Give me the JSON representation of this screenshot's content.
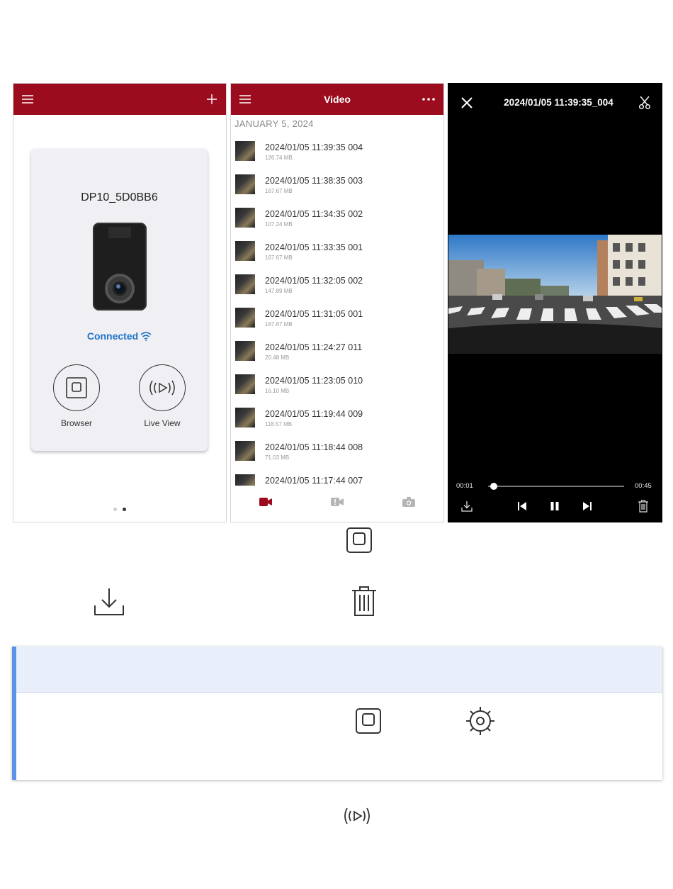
{
  "colors": {
    "brand_red": "#9b0c1e",
    "connected_blue": "#1f74c9",
    "accent_blue": "#5b93e8"
  },
  "home": {
    "device_name": "DP10_5D0BB6",
    "status": "Connected",
    "browser_label": "Browser",
    "live_view_label": "Live View",
    "page_indicator": {
      "pages": 2,
      "current": 2
    }
  },
  "video": {
    "title": "Video",
    "date_header": "JANUARY 5, 2024",
    "items": [
      {
        "name": "2024/01/05 11:39:35  004",
        "size": "126.74 MB"
      },
      {
        "name": "2024/01/05 11:38:35  003",
        "size": "167.67 MB"
      },
      {
        "name": "2024/01/05 11:34:35  002",
        "size": "107.24 MB"
      },
      {
        "name": "2024/01/05 11:33:35  001",
        "size": "167.67 MB"
      },
      {
        "name": "2024/01/05 11:32:05  002",
        "size": "147.89 MB"
      },
      {
        "name": "2024/01/05 11:31:05  001",
        "size": "167.67 MB"
      },
      {
        "name": "2024/01/05 11:24:27  011",
        "size": "20.48 MB"
      },
      {
        "name": "2024/01/05 11:23:05  010",
        "size": "16.10 MB"
      },
      {
        "name": "2024/01/05 11:19:44  009",
        "size": "118.57 MB"
      },
      {
        "name": "2024/01/05 11:18:44  008",
        "size": "71.03 MB"
      },
      {
        "name": "2024/01/05 11:17:44  007",
        "size": ""
      }
    ],
    "tabs": [
      "video-tab",
      "event-tab",
      "photo-tab"
    ]
  },
  "player": {
    "title": "2024/01/05 11:39:35_004",
    "elapsed": "00:01",
    "duration": "00:45",
    "progress": 0.022
  },
  "icons": [
    "menu-icon",
    "plus-icon",
    "more-icon",
    "close-icon",
    "scissors-icon",
    "download-icon",
    "previous-icon",
    "pause-icon",
    "next-icon",
    "trash-icon",
    "browser-icon",
    "live-view-icon",
    "settings-icon",
    "wifi-icon"
  ]
}
